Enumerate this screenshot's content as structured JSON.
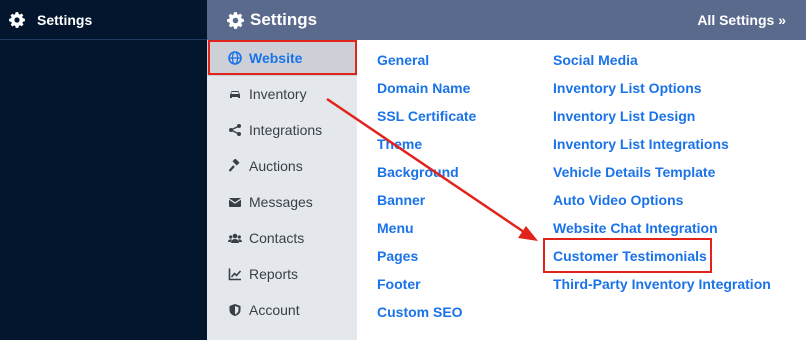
{
  "left_panel": {
    "title": "Settings"
  },
  "topbar": {
    "title": "Settings",
    "all_settings": "All Settings »"
  },
  "nav": {
    "items": [
      {
        "label": "Website",
        "icon": "globe-icon",
        "active": true
      },
      {
        "label": "Inventory",
        "icon": "car-icon"
      },
      {
        "label": "Integrations",
        "icon": "share-icon"
      },
      {
        "label": "Auctions",
        "icon": "gavel-icon"
      },
      {
        "label": "Messages",
        "icon": "envelope-icon"
      },
      {
        "label": "Contacts",
        "icon": "users-icon"
      },
      {
        "label": "Reports",
        "icon": "chart-icon"
      },
      {
        "label": "Account",
        "icon": "shield-icon"
      }
    ]
  },
  "links": {
    "col1": [
      "General",
      "Domain Name",
      "SSL Certificate",
      "Theme",
      "Background",
      "Banner",
      "Menu",
      "Pages",
      "Footer",
      "Custom SEO"
    ],
    "col2": [
      "Social Media",
      "Inventory List Options",
      "Inventory List Design",
      "Inventory List Integrations",
      "Vehicle Details Template",
      "Auto Video Options",
      "Website Chat Integration",
      "Customer Testimonials",
      "Third-Party Inventory Integration"
    ]
  },
  "colors": {
    "accent": "#1a73e8",
    "highlight": "#e0241b",
    "topbar": "#5a6a8c",
    "sidebar": "#03162e"
  }
}
